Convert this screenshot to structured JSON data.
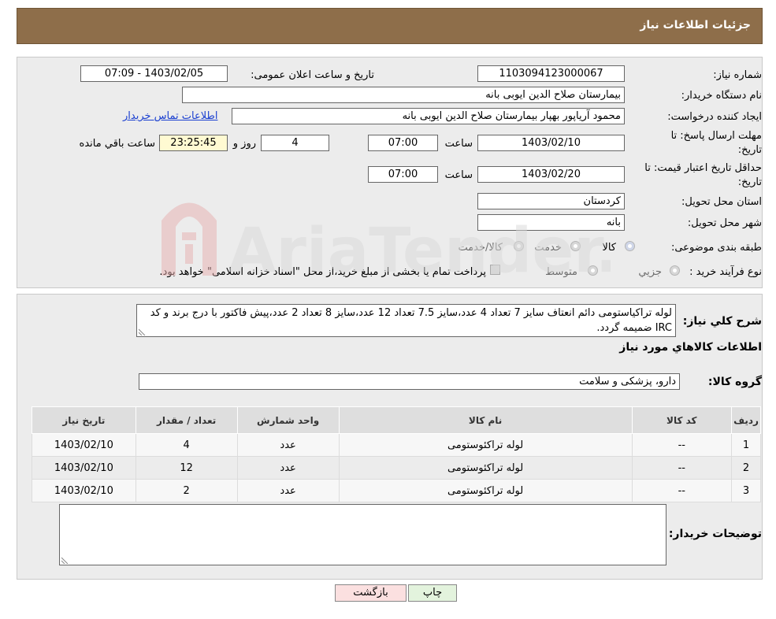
{
  "header": {
    "title": "جزئیات اطلاعات نیاز"
  },
  "form": {
    "need_number_label": "شماره نیاز:",
    "need_number": "1103094123000067",
    "announce_label": "تاریخ و ساعت اعلان عمومی:",
    "announce_value": "1403/02/05 - 07:09",
    "buyer_org_label": "نام دستگاه خریدار:",
    "buyer_org": "بیمارستان صلاح الدین ایوبی بانه",
    "creator_label": "ایجاد کننده درخواست:",
    "creator": "محمود آریاپور بهپار بیمارستان صلاح الدین ایوبی بانه",
    "contact_link": "اطلاعات تماس خریدار",
    "deadline_label_1": "مهلت ارسال پاسخ: تا",
    "deadline_label_2": "تاریخ:",
    "deadline_date": "1403/02/10",
    "time_label": "ساعت",
    "deadline_time": "07:00",
    "days_value": "4",
    "days_label": "روز و",
    "remaining_time": "23:25:45",
    "remaining_label": "ساعت باقي مانده",
    "validity_label_1": "حداقل تاریخ اعتبار قیمت: تا",
    "validity_label_2": "تاریخ:",
    "validity_date": "1403/02/20",
    "validity_time": "07:00",
    "province_label": "استان محل تحویل:",
    "province": "کردستان",
    "city_label": "شهر محل تحویل:",
    "city": "بانه",
    "category_label": "طبقه بندی موضوعی:",
    "category_options": [
      "کالا",
      "خدمت",
      "کالا/خدمت"
    ],
    "category_selected": "کالا",
    "purchase_type_label": "نوع فرآیند خرید :",
    "purchase_options": [
      "جزیي",
      "متوسط"
    ],
    "purchase_note": "پرداخت تمام یا بخشی از مبلغ خرید،از محل \"اسناد خزانه اسلامی\" خواهد بود."
  },
  "details": {
    "general_desc_label": "شرح کلي نياز:",
    "general_desc": "لوله تراکیاستومی دائم انعتاف سایز 7 تعداد 4 عدد،سایز 7.5 تعداد 12 عدد،سایز 8 تعداد 2 عدد،پیش فاکتور با درج برند و کد IRC ضمیمه گردد.",
    "goods_info_title": "اطلاعات کالاهاي مورد نياز",
    "goods_group_label": "گروه کالا:",
    "goods_group": "دارو، پزشکی و سلامت",
    "buyer_notes_label": "توضیحات خریدار:",
    "buyer_notes": ""
  },
  "table": {
    "columns": [
      "ردیف",
      "کد کالا",
      "نام کالا",
      "واحد شمارش",
      "تعداد / مقدار",
      "تاریخ نیاز"
    ],
    "rows": [
      [
        "1",
        "--",
        "لوله تراکئوستومی",
        "عدد",
        "4",
        "1403/02/10"
      ],
      [
        "2",
        "--",
        "لوله تراکئوستومی",
        "عدد",
        "12",
        "1403/02/10"
      ],
      [
        "3",
        "--",
        "لوله تراکئوستومی",
        "عدد",
        "2",
        "1403/02/10"
      ]
    ]
  },
  "buttons": {
    "print": "چاپ",
    "back": "بازگشت"
  },
  "watermark": {
    "text": "AriaTender.neT"
  },
  "colors": {
    "title_bar": "#8e6e4a",
    "link": "#1a3fd0",
    "print_button": "#e3f3dd",
    "back_button": "#fbe0e0"
  }
}
